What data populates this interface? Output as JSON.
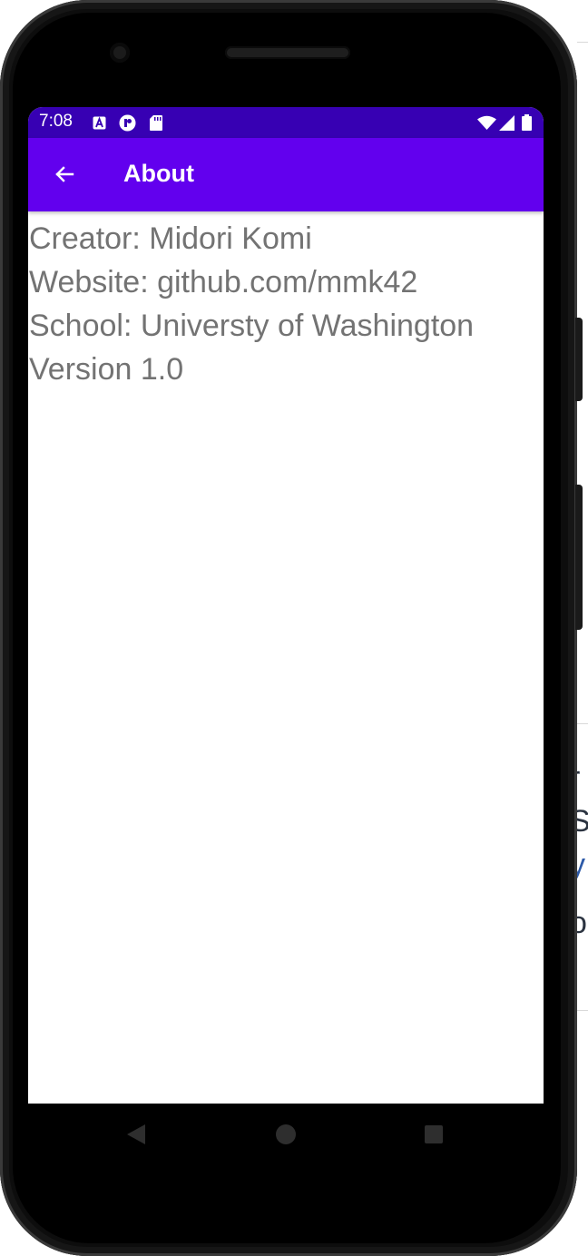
{
  "status_bar": {
    "time": "7:08",
    "left_icons": [
      "app-a-icon",
      "app-circle-icon",
      "sd-card-icon"
    ],
    "right_icons": [
      "wifi-icon",
      "cell-signal-icon",
      "battery-icon"
    ]
  },
  "app_bar": {
    "title": "About",
    "back_icon": "back-arrow-icon"
  },
  "about": {
    "lines": [
      "Creator: Midori Komi",
      "Website: github.com/mmk42",
      "School: Universty of Washington",
      "Version  1.0"
    ]
  },
  "nav_bar": {
    "buttons": [
      "back-triangle-icon",
      "home-circle-icon",
      "recents-square-icon"
    ]
  },
  "background_page": {
    "letters": [
      "r",
      "S",
      "y",
      "o"
    ]
  },
  "colors": {
    "status_bar": "#3700b3",
    "app_bar": "#6200ee",
    "body_text": "#737373",
    "device": "#0d0d0d"
  }
}
